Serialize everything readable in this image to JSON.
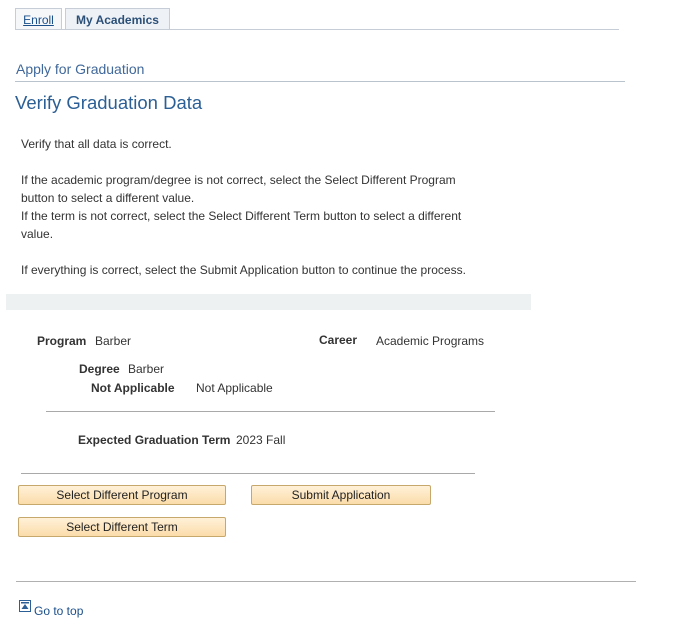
{
  "tabs": [
    {
      "label": "Enroll",
      "active": false
    },
    {
      "label": "My Academics",
      "active": true
    }
  ],
  "page": {
    "subtitle": "Apply for Graduation",
    "title": "Verify Graduation Data"
  },
  "instructions": {
    "line1": "Verify that all data is correct.",
    "line2": "If the academic program/degree is not correct, select the Select Different Program button to select a different value.",
    "line3": "If the term is not correct, select the Select Different Term button to select a different value.",
    "line4": "If everything is correct, select the Submit Application button to continue the process."
  },
  "fields": {
    "program_label": "Program",
    "program_value": "Barber",
    "career_label": "Career",
    "career_value": "Academic Programs",
    "degree_label": "Degree",
    "degree_value": "Barber",
    "na_label": "Not Applicable",
    "na_value": "Not Applicable",
    "term_label": "Expected Graduation Term",
    "term_value": "2023 Fall"
  },
  "buttons": {
    "select_program": "Select Different Program",
    "submit": "Submit Application",
    "select_term": "Select Different Term"
  },
  "footer": {
    "go_to_top": "Go to top"
  },
  "colors": {
    "link": "#1b4f8a",
    "title": "#2b5f95",
    "button_fill": "#fbdcaa",
    "button_border": "#c7a86c"
  }
}
